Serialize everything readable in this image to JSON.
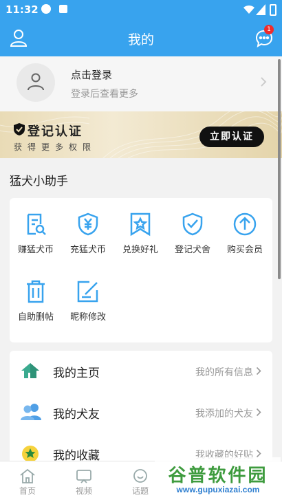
{
  "status_bar": {
    "time": "11:32"
  },
  "header": {
    "title": "我的",
    "message_badge": "1"
  },
  "login": {
    "title": "点击登录",
    "subtitle": "登录后查看更多"
  },
  "certify_banner": {
    "title": "登记认证",
    "subtitle": "获得更多权限",
    "button_label": "立即认证"
  },
  "assistant": {
    "title": "猛犬小助手",
    "items": [
      {
        "label": "赚猛犬币",
        "icon": "earn-coin-icon"
      },
      {
        "label": "充猛犬币",
        "icon": "recharge-coin-icon"
      },
      {
        "label": "兑换好礼",
        "icon": "gift-redeem-icon"
      },
      {
        "label": "登记犬舍",
        "icon": "kennel-register-icon"
      },
      {
        "label": "购买会员",
        "icon": "buy-member-icon"
      },
      {
        "label": "自助删帖",
        "icon": "delete-post-icon"
      },
      {
        "label": "昵称修改",
        "icon": "edit-nickname-icon"
      }
    ]
  },
  "menu": [
    {
      "label": "我的主页",
      "hint": "我的所有信息",
      "icon": "home-page-icon"
    },
    {
      "label": "我的犬友",
      "hint": "我添加的犬友",
      "icon": "friends-icon"
    },
    {
      "label": "我的收藏",
      "hint": "我收藏的好贴",
      "icon": "favorites-icon"
    }
  ],
  "tabbar": [
    {
      "label": "首页",
      "icon": "home-icon"
    },
    {
      "label": "视频",
      "icon": "video-icon"
    },
    {
      "label": "话题",
      "icon": "topic-icon"
    }
  ],
  "watermark": {
    "text": "谷普软件园",
    "url": "www.gupuxiazai.com"
  },
  "colors": {
    "primary": "#38a3ee",
    "accent_gold": "#e9dbb6",
    "badge": "#f02b2b"
  }
}
